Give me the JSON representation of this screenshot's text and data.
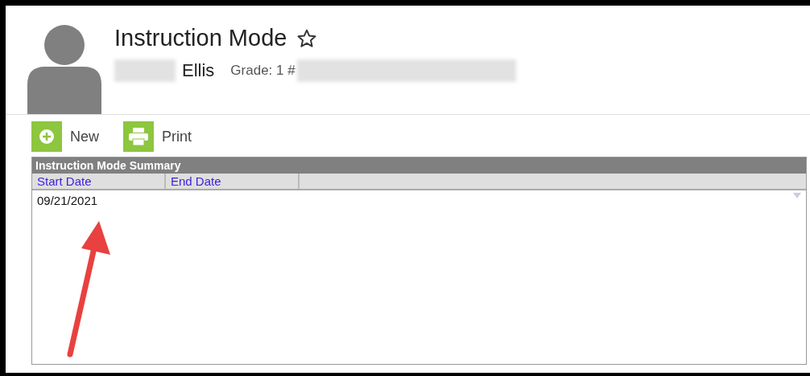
{
  "header": {
    "title": "Instruction Mode",
    "student_last_name": "Ellis",
    "grade_label": "Grade: 1 #"
  },
  "toolbar": {
    "buttons": [
      {
        "kind": "new",
        "label": "New"
      },
      {
        "kind": "print",
        "label": "Print"
      }
    ]
  },
  "table": {
    "title": "Instruction Mode Summary",
    "columns": [
      "Start Date",
      "End Date"
    ],
    "rows": [
      [
        "09/21/2021",
        ""
      ]
    ]
  }
}
